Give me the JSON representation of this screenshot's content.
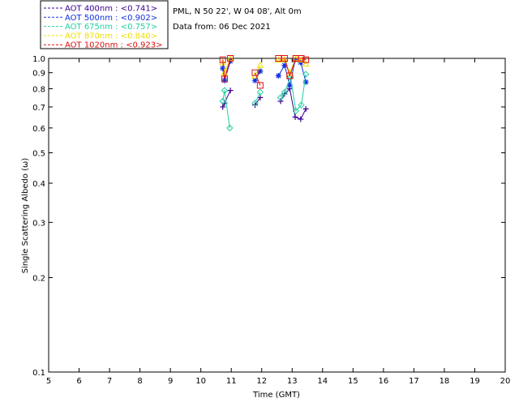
{
  "header": {
    "site_line": "PML, N 50 22', W 04 08', Alt 0m",
    "date_line": "Data from: 06 Dec 2021"
  },
  "legend": [
    {
      "label": "AOT  400nm : <0.741>",
      "color": "#3a0090"
    },
    {
      "label": "AOT  500nm : <0.902>",
      "color": "#1030e0"
    },
    {
      "label": "AOT  675nm : <0.757>",
      "color": "#20d0a0"
    },
    {
      "label": "AOT  870nm : <0.840>",
      "color": "#f0e000"
    },
    {
      "label": "AOT 1020nm : <0.923>",
      "color": "#e01010"
    }
  ],
  "chart_data": {
    "type": "scatter",
    "xlabel": "Time (GMT)",
    "ylabel": "Single Scattering Albedo (ω)",
    "xlim": [
      5,
      20
    ],
    "ylim": [
      0.1,
      1.0
    ],
    "yscale": "log",
    "x_ticks": [
      "5",
      "6",
      "7",
      "8",
      "9",
      "10",
      "11",
      "12",
      "13",
      "14",
      "15",
      "16",
      "17",
      "18",
      "19",
      "20"
    ],
    "y_ticks": [
      "1.0",
      "0.9",
      "0.8",
      "0.7",
      "0.6",
      "0.5",
      "0.4",
      "0.3",
      "0.2",
      "0.1"
    ],
    "y_tick_values": [
      1.0,
      0.9,
      0.8,
      0.7,
      0.6,
      0.5,
      0.4,
      0.3,
      0.2,
      0.1
    ],
    "series": [
      {
        "name": "AOT  400nm",
        "marker": "plus",
        "color": "#3a0090",
        "x": [
          10.72,
          10.78,
          10.97,
          11.78,
          11.95,
          12.62,
          12.75,
          12.92,
          13.1,
          13.28,
          13.45
        ],
        "y": [
          0.7,
          0.72,
          0.79,
          0.71,
          0.75,
          0.73,
          0.77,
          0.8,
          0.65,
          0.64,
          0.69
        ]
      },
      {
        "name": "AOT  500nm",
        "marker": "asterisk",
        "color": "#1030e0",
        "x": [
          10.72,
          10.78,
          10.97,
          11.78,
          11.95,
          12.55,
          12.75,
          12.92,
          13.1,
          13.28,
          13.45
        ],
        "y": [
          0.93,
          0.85,
          0.98,
          0.85,
          0.91,
          0.88,
          0.95,
          0.82,
          0.99,
          0.97,
          0.84
        ]
      },
      {
        "name": "AOT  675nm",
        "marker": "diamond",
        "color": "#20d0a0",
        "x": [
          10.72,
          10.78,
          10.95,
          11.78,
          11.95,
          12.62,
          12.75,
          12.95,
          13.12,
          13.3,
          13.45
        ],
        "y": [
          0.73,
          0.79,
          0.6,
          0.72,
          0.78,
          0.75,
          0.78,
          0.87,
          0.68,
          0.71,
          0.89
        ]
      },
      {
        "name": "AOT  870nm",
        "marker": "triangle",
        "color": "#f0e000",
        "x": [
          10.72,
          10.78,
          10.97,
          11.78,
          11.95,
          12.55,
          12.75,
          12.92,
          13.12,
          13.3,
          13.45
        ],
        "y": [
          0.97,
          0.9,
          1.0,
          0.88,
          0.95,
          0.99,
          0.99,
          0.9,
          1.0,
          0.99,
          0.96
        ]
      },
      {
        "name": "AOT 1020nm",
        "marker": "square",
        "color": "#e01010",
        "x": [
          10.72,
          10.78,
          10.97,
          11.78,
          11.95,
          12.55,
          12.75,
          12.92,
          13.12,
          13.3,
          13.45
        ],
        "y": [
          0.99,
          0.86,
          1.0,
          0.9,
          0.82,
          1.0,
          1.0,
          0.88,
          1.0,
          1.0,
          0.99
        ]
      }
    ]
  }
}
